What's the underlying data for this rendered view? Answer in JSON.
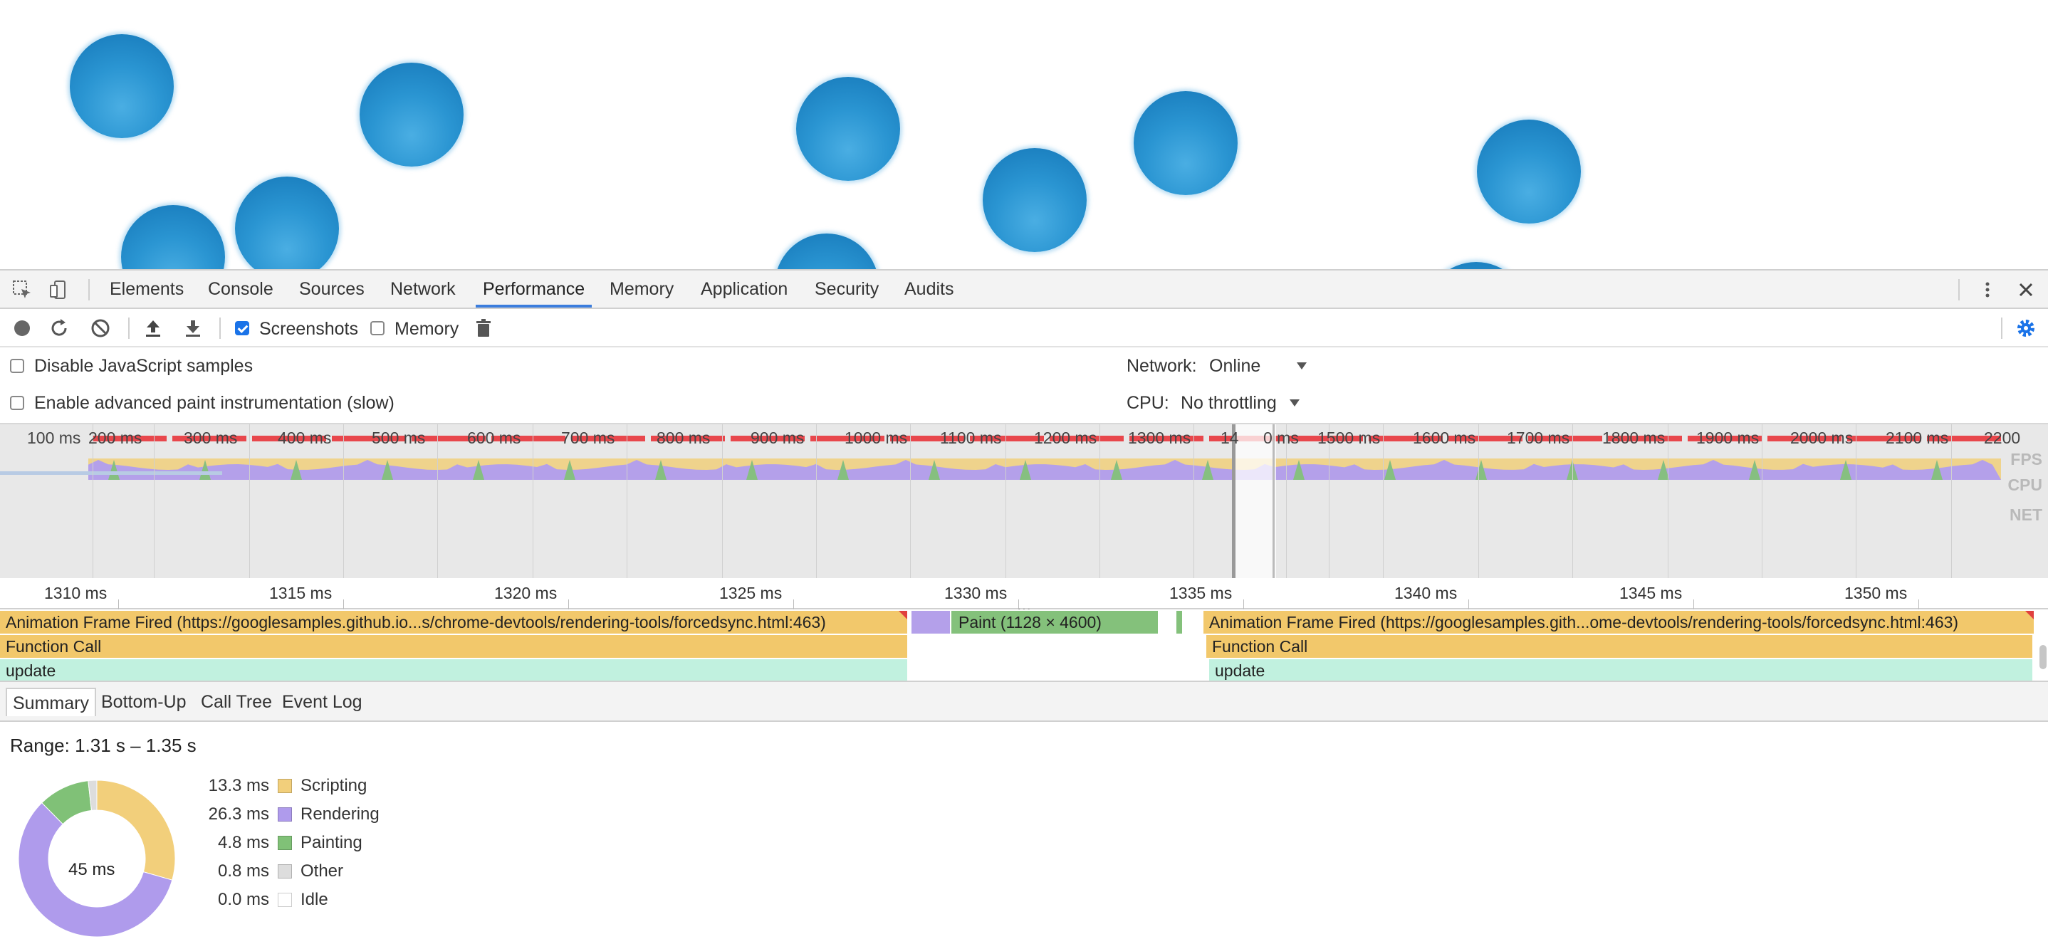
{
  "devtools_tabs": [
    "Elements",
    "Console",
    "Sources",
    "Network",
    "Performance",
    "Memory",
    "Application",
    "Security",
    "Audits"
  ],
  "active_tab": "Performance",
  "toolbar": {
    "screenshots_label": "Screenshots",
    "screenshots_checked": true,
    "memory_label": "Memory",
    "memory_checked": false
  },
  "settings": {
    "disable_js_samples": "Disable JavaScript samples",
    "enable_paint": "Enable advanced paint instrumentation (slow)",
    "network_label": "Network:",
    "network_value": "Online",
    "cpu_label": "CPU:",
    "cpu_value": "No throttling"
  },
  "overview": {
    "ruler": [
      "100 ms",
      "200 ms",
      "300 ms",
      "400 ms",
      "500 ms",
      "600 ms",
      "700 ms",
      "800 ms",
      "900 ms",
      "1000 ms",
      "1100 ms",
      "1200 ms",
      "1300 ms",
      "14",
      "0 ms",
      "1500 ms",
      "1600 ms",
      "1700 ms",
      "1800 ms",
      "1900 ms",
      "2000 ms",
      "2100 ms",
      "2200"
    ],
    "labels": {
      "fps": "FPS",
      "cpu": "CPU",
      "net": "NET"
    }
  },
  "detail_ruler": [
    "1310 ms",
    "1315 ms",
    "1320 ms",
    "1325 ms",
    "1330 ms",
    "1335 ms",
    "1340 ms",
    "1345 ms",
    "1350 ms"
  ],
  "flame": {
    "anim1": "Animation Frame Fired (https://googlesamples.github.io...s/chrome-devtools/rendering-tools/forcedsync.html:463)",
    "paint": "Paint (1128 × 4600)",
    "anim2": "Animation Frame Fired (https://googlesamples.gith...ome-devtools/rendering-tools/forcedsync.html:463)",
    "function_call": "Function Call",
    "update": "update"
  },
  "bottom_tabs": [
    "Summary",
    "Bottom-Up",
    "Call Tree",
    "Event Log"
  ],
  "active_bottom_tab": "Summary",
  "summary": {
    "range": "Range: 1.31 s – 1.35 s",
    "total": "45 ms",
    "items": [
      {
        "value": "13.3 ms",
        "label": "Scripting",
        "color": "#f2cf7b"
      },
      {
        "value": "26.3 ms",
        "label": "Rendering",
        "color": "#af9bec"
      },
      {
        "value": "4.8 ms",
        "label": "Painting",
        "color": "#80c177"
      },
      {
        "value": "0.8 ms",
        "label": "Other",
        "color": "#dddddd"
      },
      {
        "value": "0.0 ms",
        "label": "Idle",
        "color": "#ffffff"
      }
    ]
  },
  "colors": {
    "accent": "#3b7ddd",
    "scripting": "#f2cf7b",
    "rendering": "#af9bec",
    "painting": "#80c177",
    "update": "#c1f1df",
    "fps_red": "#e8474c"
  }
}
